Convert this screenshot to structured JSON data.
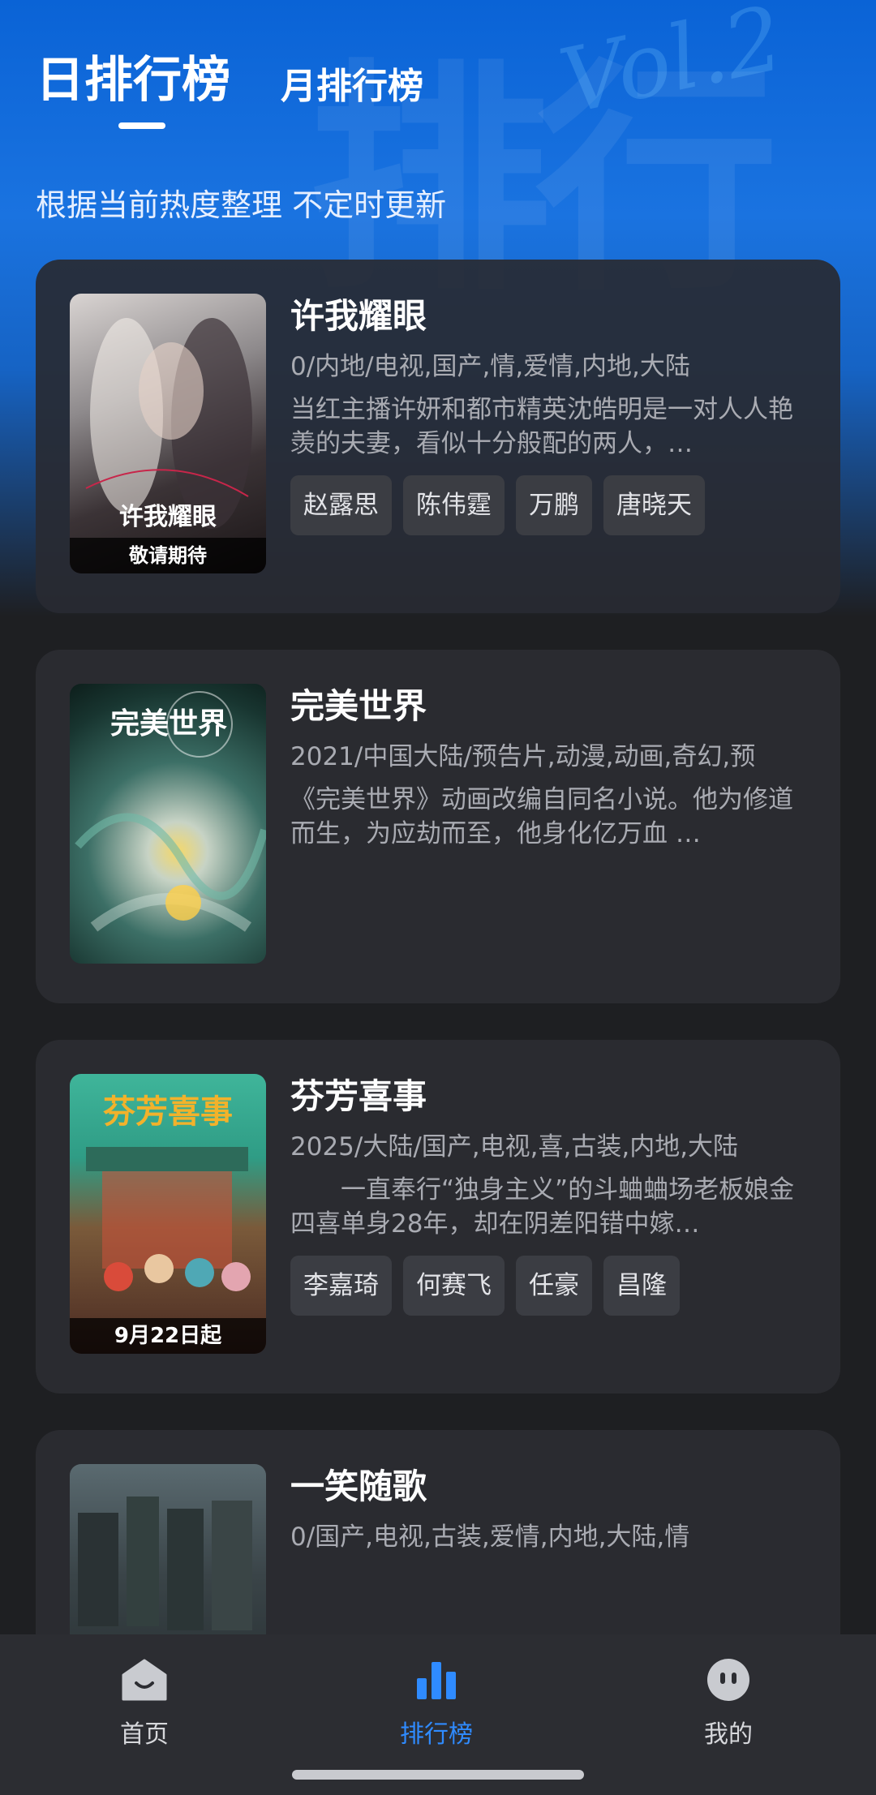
{
  "header": {
    "tab_daily": "日排行榜",
    "tab_monthly": "月排行榜",
    "subtitle": "根据当前热度整理 不定时更新"
  },
  "items": [
    {
      "title": "许我耀眼",
      "meta": "0/内地/电视,国产,情,爱情,内地,大陆",
      "desc": "当红主播许妍和都市精英沈皓明是一对人人艳羡的夫妻，看似十分般配的两人，…",
      "actors": [
        "赵露思",
        "陈伟霆",
        "万鹏",
        "唐晓天"
      ],
      "poster_caption": "敬请期待",
      "poster_title": "许我耀眼"
    },
    {
      "title": "完美世界",
      "meta": "2021/中国大陆/预告片,动漫,动画,奇幻,预",
      "desc": "《完美世界》动画改编自同名小说。他为修道而生，为应劫而至，他身化亿万血 …",
      "actors": [],
      "poster_caption": "",
      "poster_title": "完美世界"
    },
    {
      "title": "芬芳喜事",
      "meta": "2025/大陆/国产,电视,喜,古装,内地,大陆",
      "desc": "　　一直奉行“独身主义”的斗蛐蛐场老板娘金四喜单身28年，却在阴差阳错中嫁…",
      "actors": [
        "李嘉琦",
        "何赛飞",
        "任豪",
        "昌隆"
      ],
      "poster_caption": "9月22日起",
      "poster_title": "芬芳喜事"
    },
    {
      "title": "一笑随歌",
      "meta": "0/国产,电视,古装,爱情,内地,大陆,情",
      "desc": "",
      "actors": [],
      "poster_caption": "",
      "poster_title": ""
    }
  ],
  "nav": {
    "home": "首页",
    "ranking": "排行榜",
    "mine": "我的"
  },
  "colors": {
    "accent": "#2f8bff",
    "card_bg": "#2a2b30",
    "page_bg": "#1e1f22"
  }
}
